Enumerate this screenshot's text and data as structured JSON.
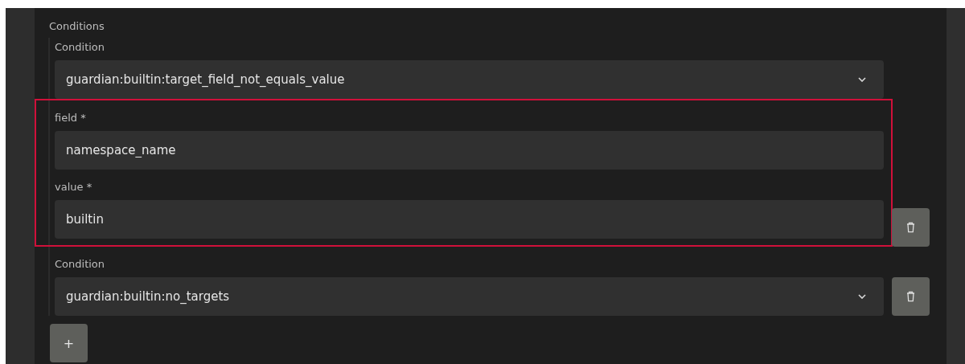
{
  "section": {
    "title": "Conditions"
  },
  "conditions": [
    {
      "label": "Condition",
      "value": "guardian:builtin:target_field_not_equals_value",
      "highlighted": true,
      "params": [
        {
          "label": "field *",
          "value": "namespace_name"
        },
        {
          "label": "value *",
          "value": "builtin"
        }
      ]
    },
    {
      "label": "Condition",
      "value": "guardian:builtin:no_targets"
    }
  ],
  "add_button": {
    "label": "+"
  }
}
